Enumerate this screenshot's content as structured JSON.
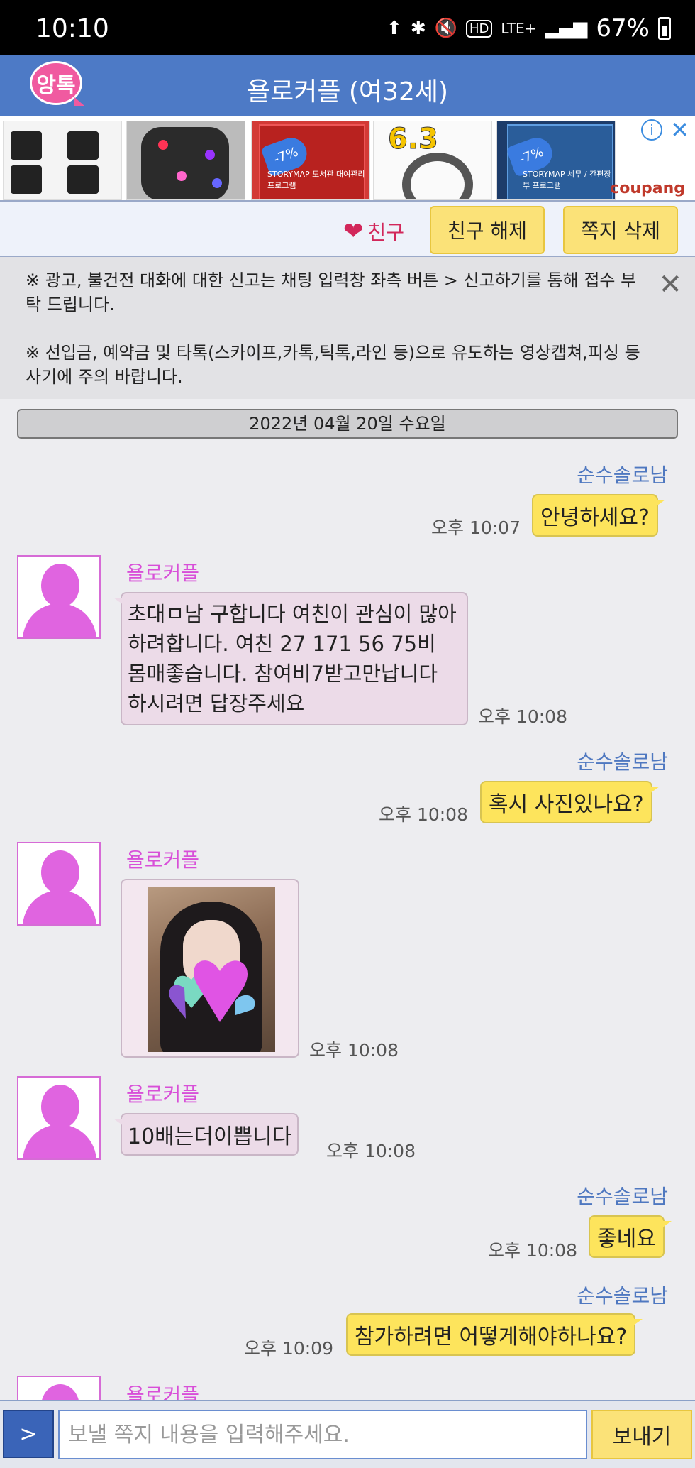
{
  "status_bar": {
    "time": "10:10",
    "battery": "67%"
  },
  "header": {
    "logo_text": "앙톡",
    "title": "욜로커플 (여32세)"
  },
  "ad": {
    "tags": [
      "-7%",
      "-7%"
    ],
    "promo_number": "6.3",
    "product_text_1": "STORYMAP 도서관 대여관리 프로그램",
    "product_text_2": "STORYMAP 세무 / 간편장부 프로그램",
    "brand": "coupang"
  },
  "actions": {
    "friend_label": "친구",
    "unfriend_label": "친구 해제",
    "delete_label": "쪽지 삭제"
  },
  "notice": {
    "line1": "※ 광고, 불건전 대화에 대한 신고는 채팅 입력창 좌측 버튼 > 신고하기를 통해 접수 부탁 드립니다.",
    "line2": "※ 선입금, 예약금 및 타톡(스카이프,카톡,틱톡,라인 등)으로 유도하는 영상캡쳐,피싱 등 사기에 주의 바랍니다."
  },
  "date_divider": "2022년 04월 20일 수요일",
  "messages": [
    {
      "sender": "순수솔로남",
      "text": "안녕하세요?",
      "time": "오후 10:07"
    },
    {
      "sender": "욜로커플",
      "text": "초대ㅁ남 구합니다 여친이 관심이 많아 하려합니다. 여친 27 171 56 75비 몸매좋습니다. 참여비7받고만납니다 하시려면 답장주세요",
      "time": "오후 10:08"
    },
    {
      "sender": "순수솔로남",
      "text": "혹시 사진있나요?",
      "time": "오후 10:08"
    },
    {
      "sender": "욜로커플",
      "text": "",
      "time": "오후 10:08"
    },
    {
      "sender": "욜로커플",
      "text": "10배는더이쁩니다",
      "time": "오후 10:08"
    },
    {
      "sender": "순수솔로남",
      "text": "좋네요",
      "time": "오후 10:08"
    },
    {
      "sender": "순수솔로남",
      "text": "참가하려면 어떻게해야하나요?",
      "time": "오후 10:09"
    },
    {
      "sender": "욜로커플",
      "text": "",
      "time": ""
    }
  ],
  "input": {
    "menu_label": ">",
    "placeholder": "보낼 쪽지 내용을 입력해주세요.",
    "send_label": "보내기"
  },
  "colors": {
    "header": "#4d7ac6",
    "my_bubble": "#fde45c",
    "her_bubble": "#ecdbe8",
    "my_name": "#4f78c0",
    "her_name": "#d84fd8"
  }
}
